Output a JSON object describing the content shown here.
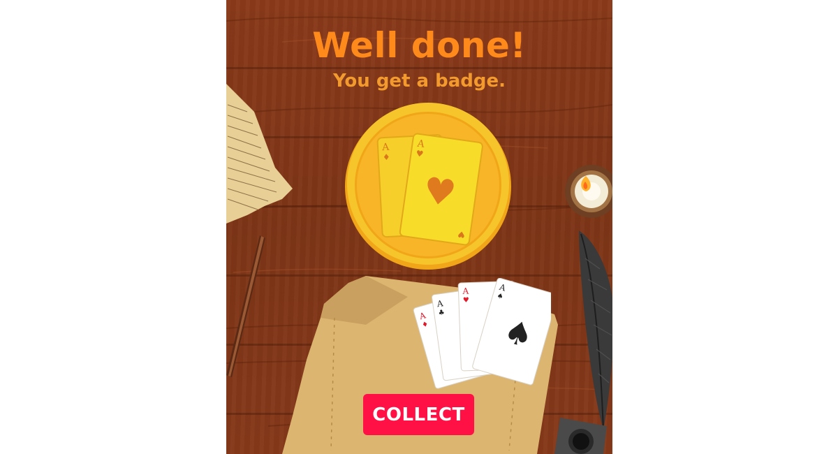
{
  "reward": {
    "title": "Well done!",
    "subtitle": "You get a badge.",
    "collect_label": "COLLECT"
  },
  "badge": {
    "back_card_rank": "A",
    "front_card_rank": "A",
    "front_card_suit": "heart"
  },
  "hand": {
    "cards": [
      {
        "rank": "A",
        "suit": "diamond"
      },
      {
        "rank": "A",
        "suit": "club"
      },
      {
        "rank": "A",
        "suit": "heart"
      },
      {
        "rank": "A",
        "suit": "spade"
      }
    ]
  },
  "colors": {
    "title": "#ff8a1c",
    "subtitle": "#f29a2e",
    "button": "#ff1146",
    "table_wood": "#8a3a1a",
    "coin_gold": "#f5b324"
  }
}
